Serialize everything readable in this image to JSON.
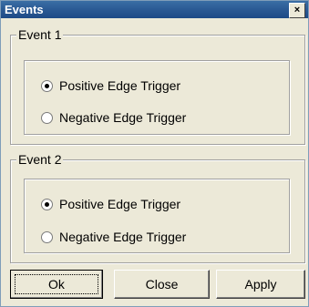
{
  "window": {
    "title": "Events",
    "close_glyph": "×"
  },
  "groups": [
    {
      "title": "Event 1",
      "options": [
        {
          "label": "Positive Edge Trigger",
          "selected": true
        },
        {
          "label": "Negative Edge Trigger",
          "selected": false
        }
      ]
    },
    {
      "title": "Event 2",
      "options": [
        {
          "label": "Positive Edge Trigger",
          "selected": true
        },
        {
          "label": "Negative Edge Trigger",
          "selected": false
        }
      ]
    }
  ],
  "buttons": {
    "ok": "Ok",
    "close": "Close",
    "apply": "Apply"
  }
}
